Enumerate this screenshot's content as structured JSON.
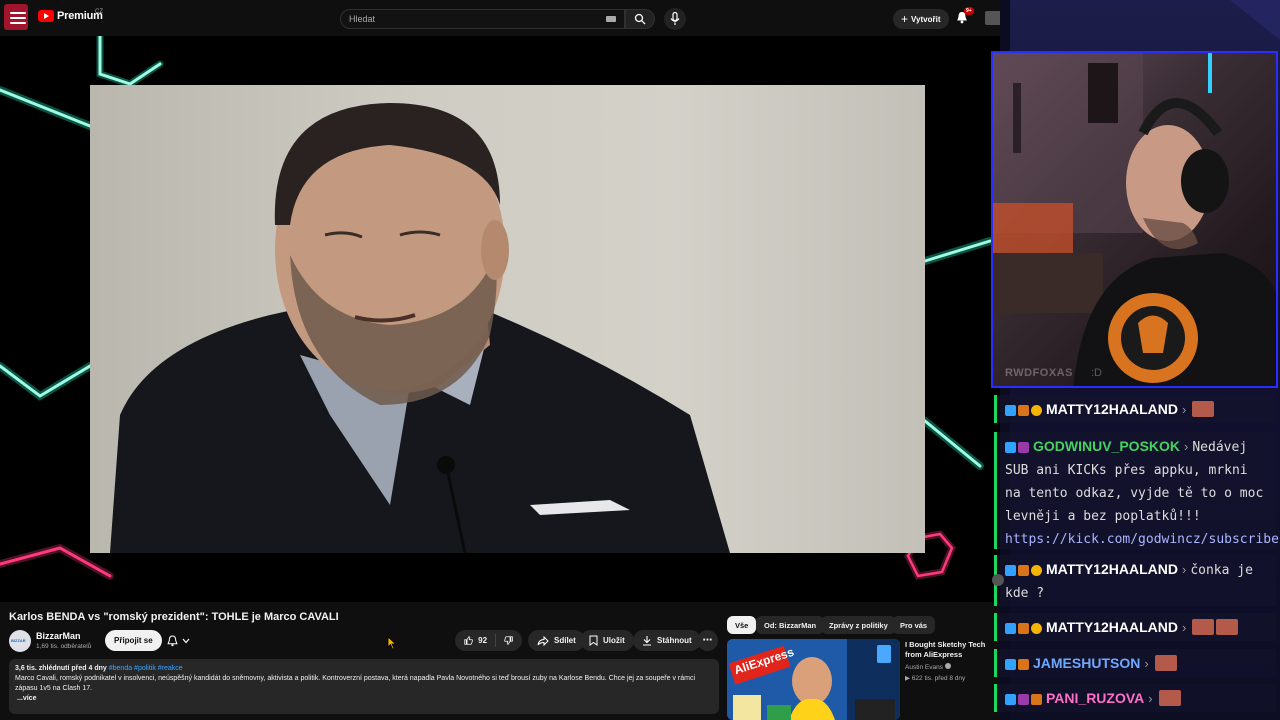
{
  "youtube": {
    "logo": "Premium",
    "logo_region": "CZ",
    "search_placeholder": "Hledat",
    "create_label": "Vytvořit",
    "notifications_badge": "9+",
    "video": {
      "title": "Karlos BENDA vs \"romský prezident\": TOHLE je Marco CAVALI",
      "channel": "BizzarMan",
      "subscribers": "1,69 tis. odběratelů",
      "join_label": "Připojit se",
      "likes": "92",
      "share_label": "Sdílet",
      "save_label": "Uložit",
      "download_label": "Stáhnout",
      "views_time": "3,6 tis. zhlédnutí  před 4 dny",
      "tags": "#benda #politik #reakce",
      "description": "Marco Cavali, romský podnikatel v insolvenci, neúspěšný kandidát do sněmovny, aktivista a politik. Kontroverzní postava, která napadla Pavla Novotného si teď brousí zuby na Karlose Bendu. Chce jej za soupeře v rámci zápasu 1v5 na Clash 17.",
      "more_label": "...více"
    },
    "chips": [
      "Vše",
      "Od: BizzarMan",
      "Zprávy z politiky",
      "Pro vás"
    ],
    "related": {
      "title": "I Bought Sketchy Tech from AliExpress",
      "channel": "Austin Evans",
      "meta": "622 tis.  před 8 dny",
      "thumb_text": "AliExpress"
    }
  },
  "stream": {
    "cam_overlay_user": "RWDFOXAS",
    "cam_overlay_msg": ":D",
    "chat": [
      {
        "user": "MATTY12HAALAND",
        "color": "#ffffff",
        "text": "",
        "emotes": 1
      },
      {
        "user": "GODWINUV_POSKOK",
        "color": "#46d160",
        "text": "Nedávej SUB ani KICKs přes appku, mrkni na tento odkaz, vyjde tě to o moc levněji a bez poplatků!!!",
        "link": "https://kick.com/godwincz/subscribe"
      },
      {
        "user": "MATTY12HAALAND",
        "color": "#ffffff",
        "text": "čonka je kde ?"
      },
      {
        "user": "MATTY12HAALAND",
        "color": "#ffffff",
        "text": "",
        "emotes": 2
      },
      {
        "user": "JAMESHUTSON",
        "color": "#6fa8ff",
        "text": "",
        "emotes": 1
      },
      {
        "user": "PANI_RUZOVA",
        "color": "#ff6ec7",
        "text": "",
        "emotes": 1
      }
    ]
  }
}
